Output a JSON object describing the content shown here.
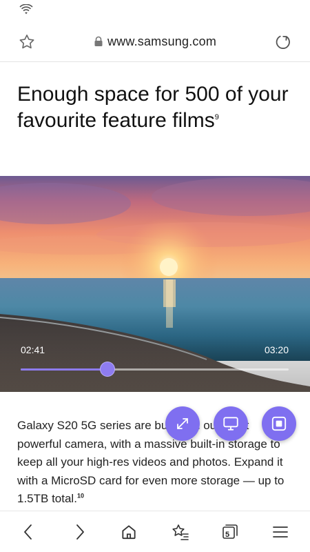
{
  "browser": {
    "url": "www.samsung.com"
  },
  "article": {
    "headline": "Enough space for 500 of your favourite feature films",
    "headline_footnote": "9",
    "body": "Galaxy S20 5G series are built with our most powerful camera, with a massive built-in storage to keep all your high-res videos and photos. Expand it with a MicroSD card for even more storage — up to 1.5TB total.",
    "body_footnote": "10"
  },
  "video": {
    "current_time": "02:41",
    "total_time": "03:20",
    "progress": 0.325
  },
  "bottom_nav": {
    "tab_count": "5"
  },
  "colors": {
    "accent": "#7f6ff0",
    "progress": "#8e7cf0"
  },
  "icons": [
    "wifi-icon",
    "star-icon",
    "lock-icon",
    "reload-icon",
    "expand-icon",
    "screen-mirror-icon",
    "popup-player-icon",
    "back-icon",
    "forward-icon",
    "home-icon",
    "bookmarks-icon",
    "tabs-icon",
    "menu-icon"
  ]
}
